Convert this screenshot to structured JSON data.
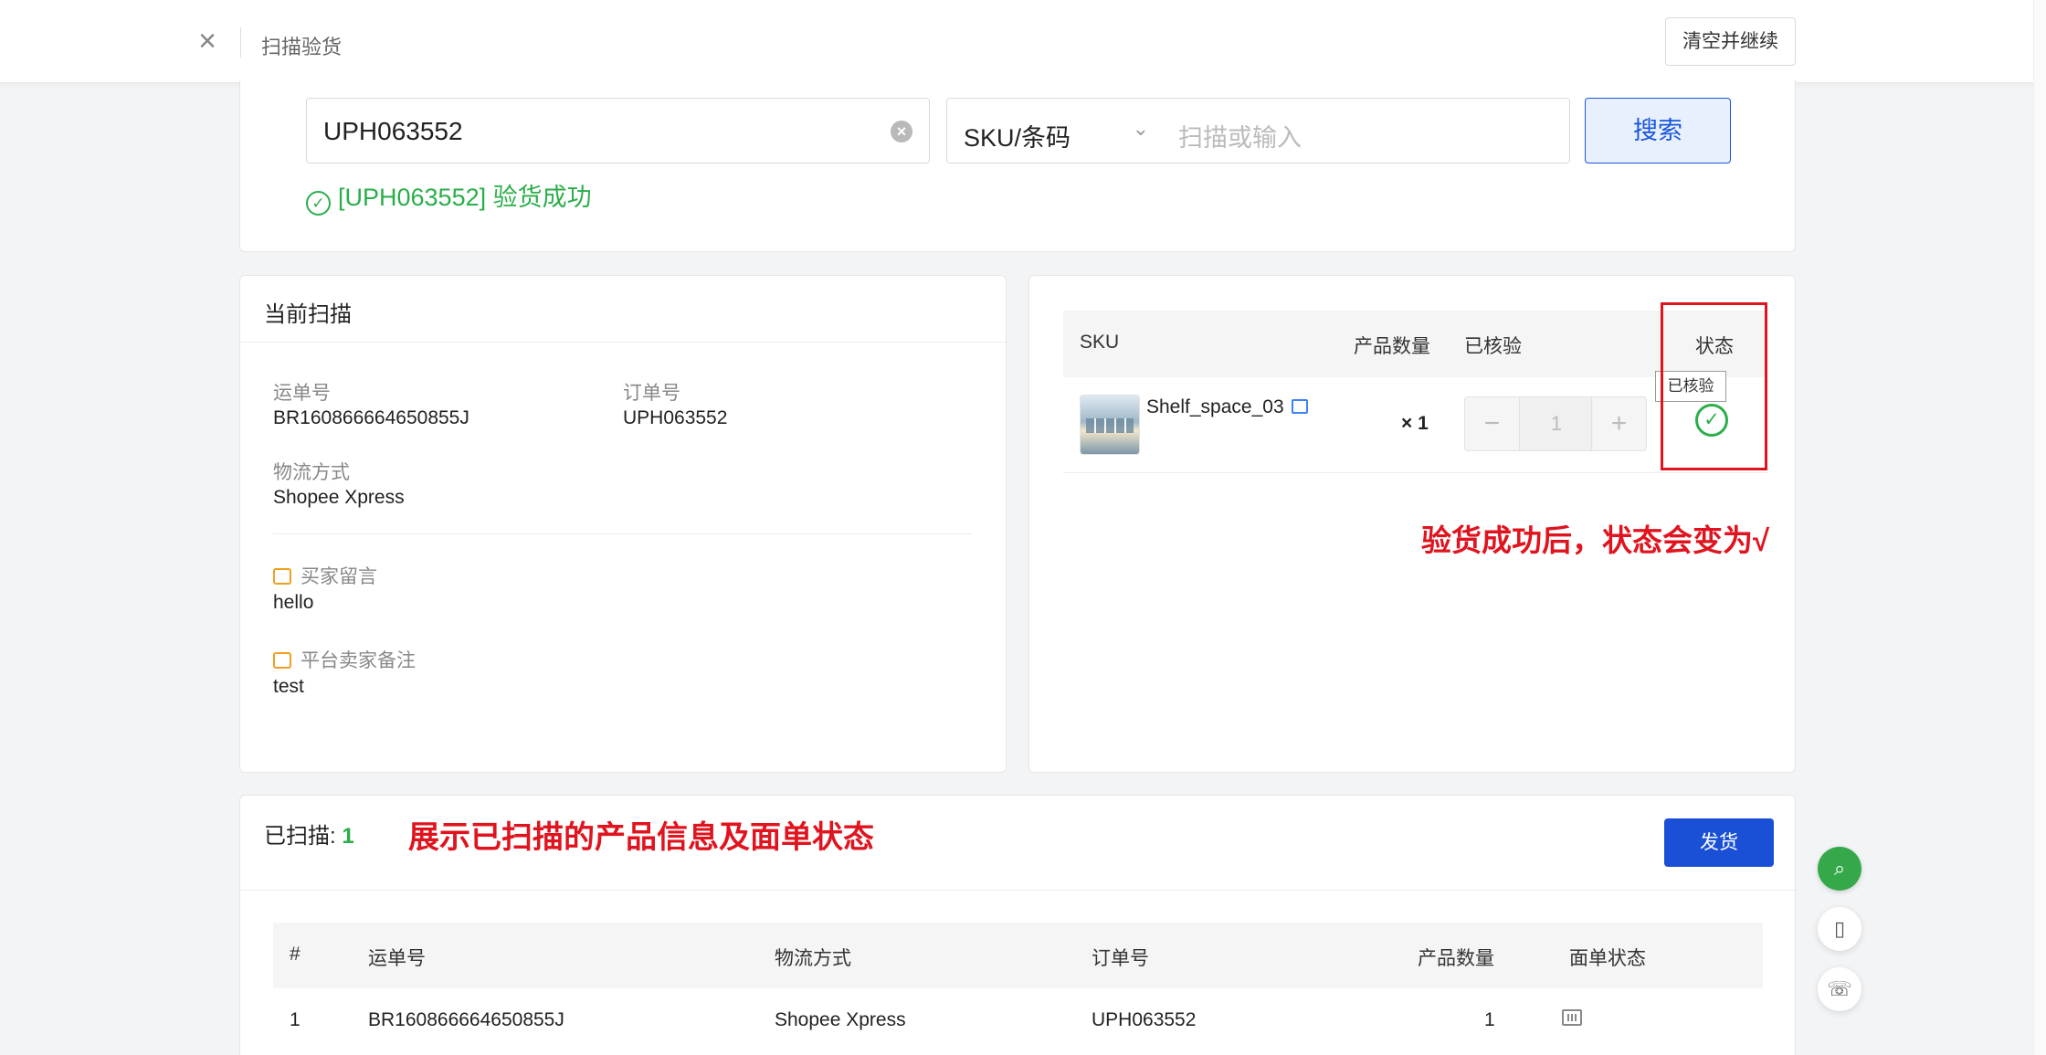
{
  "topbar": {
    "close_icon": "close-icon",
    "title": "扫描验货",
    "clear_continue": "清空并继续"
  },
  "search": {
    "order_value": "UPH063552",
    "type_select": "SKU/条码",
    "scan_placeholder": "扫描或输入",
    "search_button": "搜索",
    "success_message": "[UPH063552] 验货成功"
  },
  "current_scan": {
    "heading": "当前扫描",
    "waybill_label": "运单号",
    "waybill_value": "BR160866664650855J",
    "order_label": "订单号",
    "order_value": "UPH063552",
    "logistics_label": "物流方式",
    "logistics_value": "Shopee Xpress",
    "buyer_note_label": "买家留言",
    "buyer_note_value": "hello",
    "seller_note_label": "平台卖家备注",
    "seller_note_value": "test"
  },
  "sku_table": {
    "headers": {
      "sku": "SKU",
      "qty": "产品数量",
      "verified": "已核验",
      "status": "状态"
    },
    "row": {
      "name": "Shelf_space_03",
      "qty": "× 1",
      "minus": "−",
      "count": "1",
      "plus": "+",
      "status_tooltip": "已核验"
    },
    "annotation": "验货成功后，状态会变为√"
  },
  "scanned": {
    "label": "已扫描: ",
    "count": "1",
    "annotation": "展示已扫描的产品信息及面单状态",
    "ship_button": "发货",
    "headers": {
      "index": "#",
      "waybill": "运单号",
      "logistics": "物流方式",
      "order": "订单号",
      "qty": "产品数量",
      "label_status": "面单状态"
    },
    "rows": [
      {
        "index": "1",
        "waybill": "BR160866664650855J",
        "logistics": "Shopee Xpress",
        "order": "UPH063552",
        "qty": "1"
      }
    ]
  },
  "colors": {
    "primary": "#1a50d6",
    "success": "#2bae4a",
    "annotation": "#e0141e"
  }
}
